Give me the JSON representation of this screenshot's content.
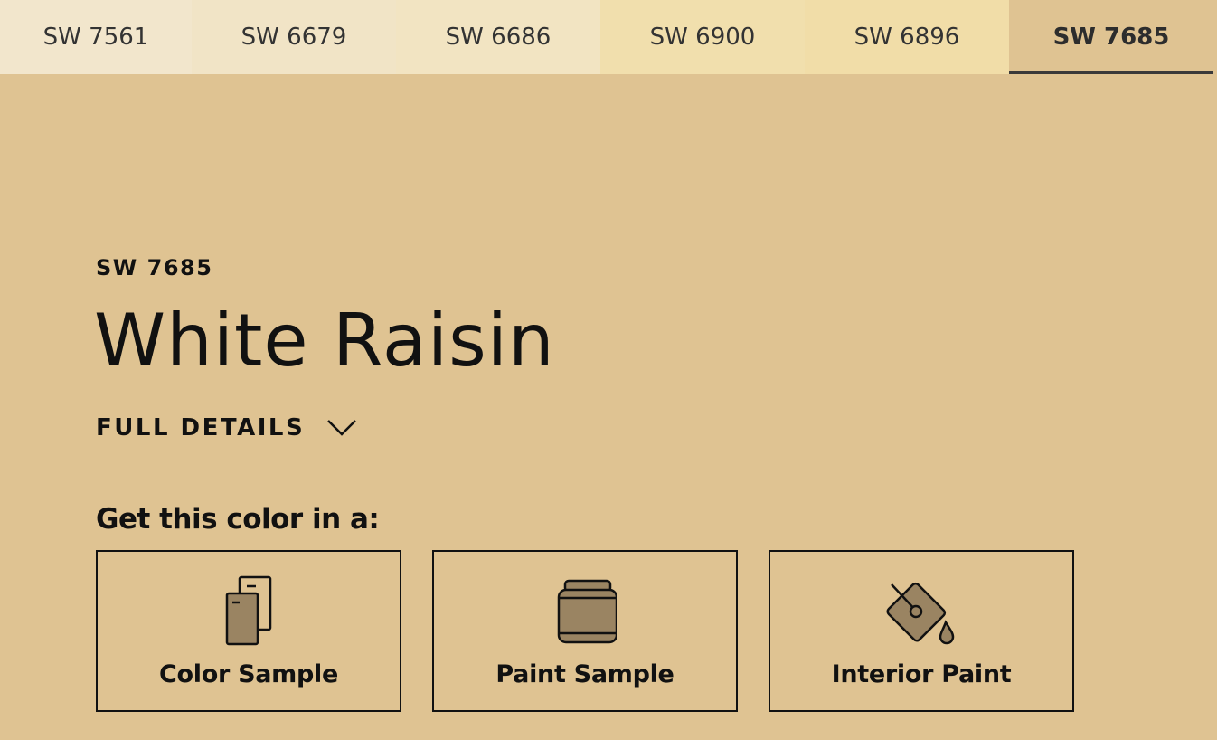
{
  "tabs": [
    {
      "label": "SW 7561",
      "color": "#f2e6cc"
    },
    {
      "label": "SW 6679",
      "color": "#f1e4c6"
    },
    {
      "label": "SW 6686",
      "color": "#f2e4c2"
    },
    {
      "label": "SW 6900",
      "color": "#f1dfad"
    },
    {
      "label": "SW 6896",
      "color": "#f1dda8"
    },
    {
      "label": "SW 7685",
      "color": "#dfc392"
    }
  ],
  "selected_tab": "SW 7685",
  "color": {
    "code": "SW 7685",
    "name": "White Raisin",
    "swatch": "#dfc392",
    "icon_fill": "#9a8462"
  },
  "details_label": "FULL DETAILS",
  "details_icon": "chevron-down-icon",
  "get_prompt": "Get this color in a:",
  "options": [
    {
      "label": "Color Sample",
      "icon": "color-sample-icon"
    },
    {
      "label": "Paint Sample",
      "icon": "paint-can-icon"
    },
    {
      "label": "Interior Paint",
      "icon": "paint-bucket-pour-icon"
    }
  ]
}
